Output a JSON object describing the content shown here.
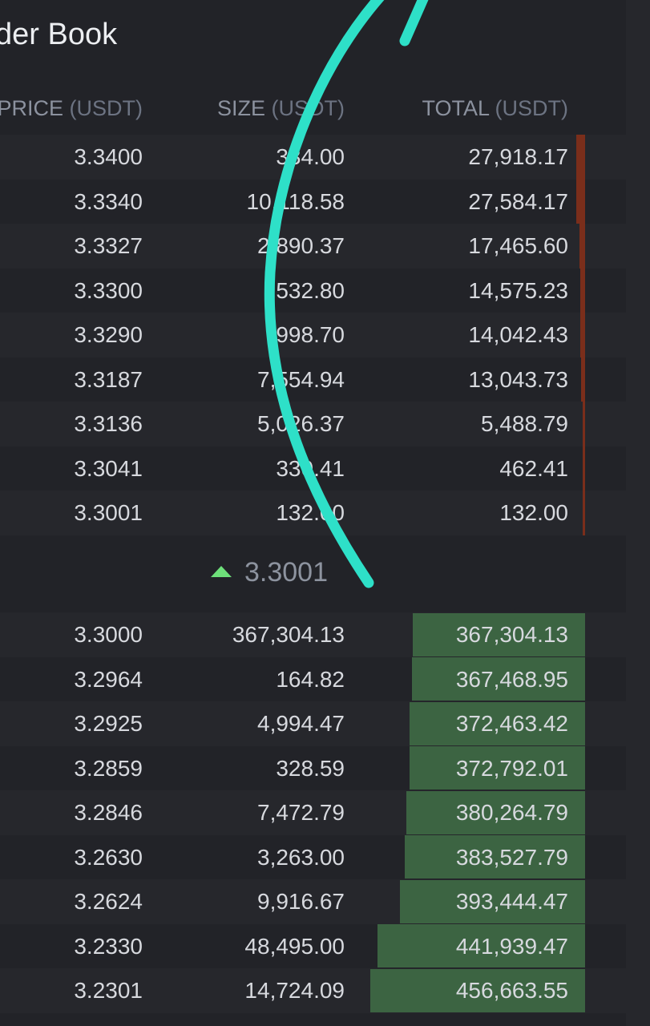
{
  "title": "der Book",
  "columns": {
    "price": "PRICE",
    "price_unit": "(USDT)",
    "size": "SIZE",
    "size_unit": "(USDT)",
    "total": "TOTAL",
    "total_unit": "(USDT)"
  },
  "colors": {
    "ask_depth": "#7a2e1b",
    "bid_depth": "#3c6442",
    "up_arrow": "#6ee07a",
    "annotation": "#2ee0c8"
  },
  "max_total": 456663.55,
  "asks": [
    {
      "price": "3.3400",
      "size": "334.00",
      "total": "27,918.17",
      "depth": 0.042
    },
    {
      "price": "3.3340",
      "size": "10,118.58",
      "total": "27,584.17",
      "depth": 0.042
    },
    {
      "price": "3.3327",
      "size": "2,890.37",
      "total": "17,465.60",
      "depth": 0.026
    },
    {
      "price": "3.3300",
      "size": "532.80",
      "total": "14,575.23",
      "depth": 0.022
    },
    {
      "price": "3.3290",
      "size": "998.70",
      "total": "14,042.43",
      "depth": 0.021
    },
    {
      "price": "3.3187",
      "size": "7,554.94",
      "total": "13,043.73",
      "depth": 0.02
    },
    {
      "price": "3.3136",
      "size": "5,026.37",
      "total": "5,488.79",
      "depth": 0.008
    },
    {
      "price": "3.3041",
      "size": "330.41",
      "total": "462.41",
      "depth": 0.003
    },
    {
      "price": "3.3001",
      "size": "132.00",
      "total": "132.00",
      "depth": 0.003
    }
  ],
  "mid_price": "3.3001",
  "bids": [
    {
      "price": "3.3000",
      "size": "367,304.13",
      "total": "367,304.13",
      "depth": 0.804
    },
    {
      "price": "3.2964",
      "size": "164.82",
      "total": "367,468.95",
      "depth": 0.805
    },
    {
      "price": "3.2925",
      "size": "4,994.47",
      "total": "372,463.42",
      "depth": 0.816
    },
    {
      "price": "3.2859",
      "size": "328.59",
      "total": "372,792.01",
      "depth": 0.816
    },
    {
      "price": "3.2846",
      "size": "7,472.79",
      "total": "380,264.79",
      "depth": 0.833
    },
    {
      "price": "3.2630",
      "size": "3,263.00",
      "total": "383,527.79",
      "depth": 0.84
    },
    {
      "price": "3.2624",
      "size": "9,916.67",
      "total": "393,444.47",
      "depth": 0.862
    },
    {
      "price": "3.2330",
      "size": "48,495.00",
      "total": "441,939.47",
      "depth": 0.968
    },
    {
      "price": "3.2301",
      "size": "14,724.09",
      "total": "456,663.55",
      "depth": 1.0
    }
  ]
}
